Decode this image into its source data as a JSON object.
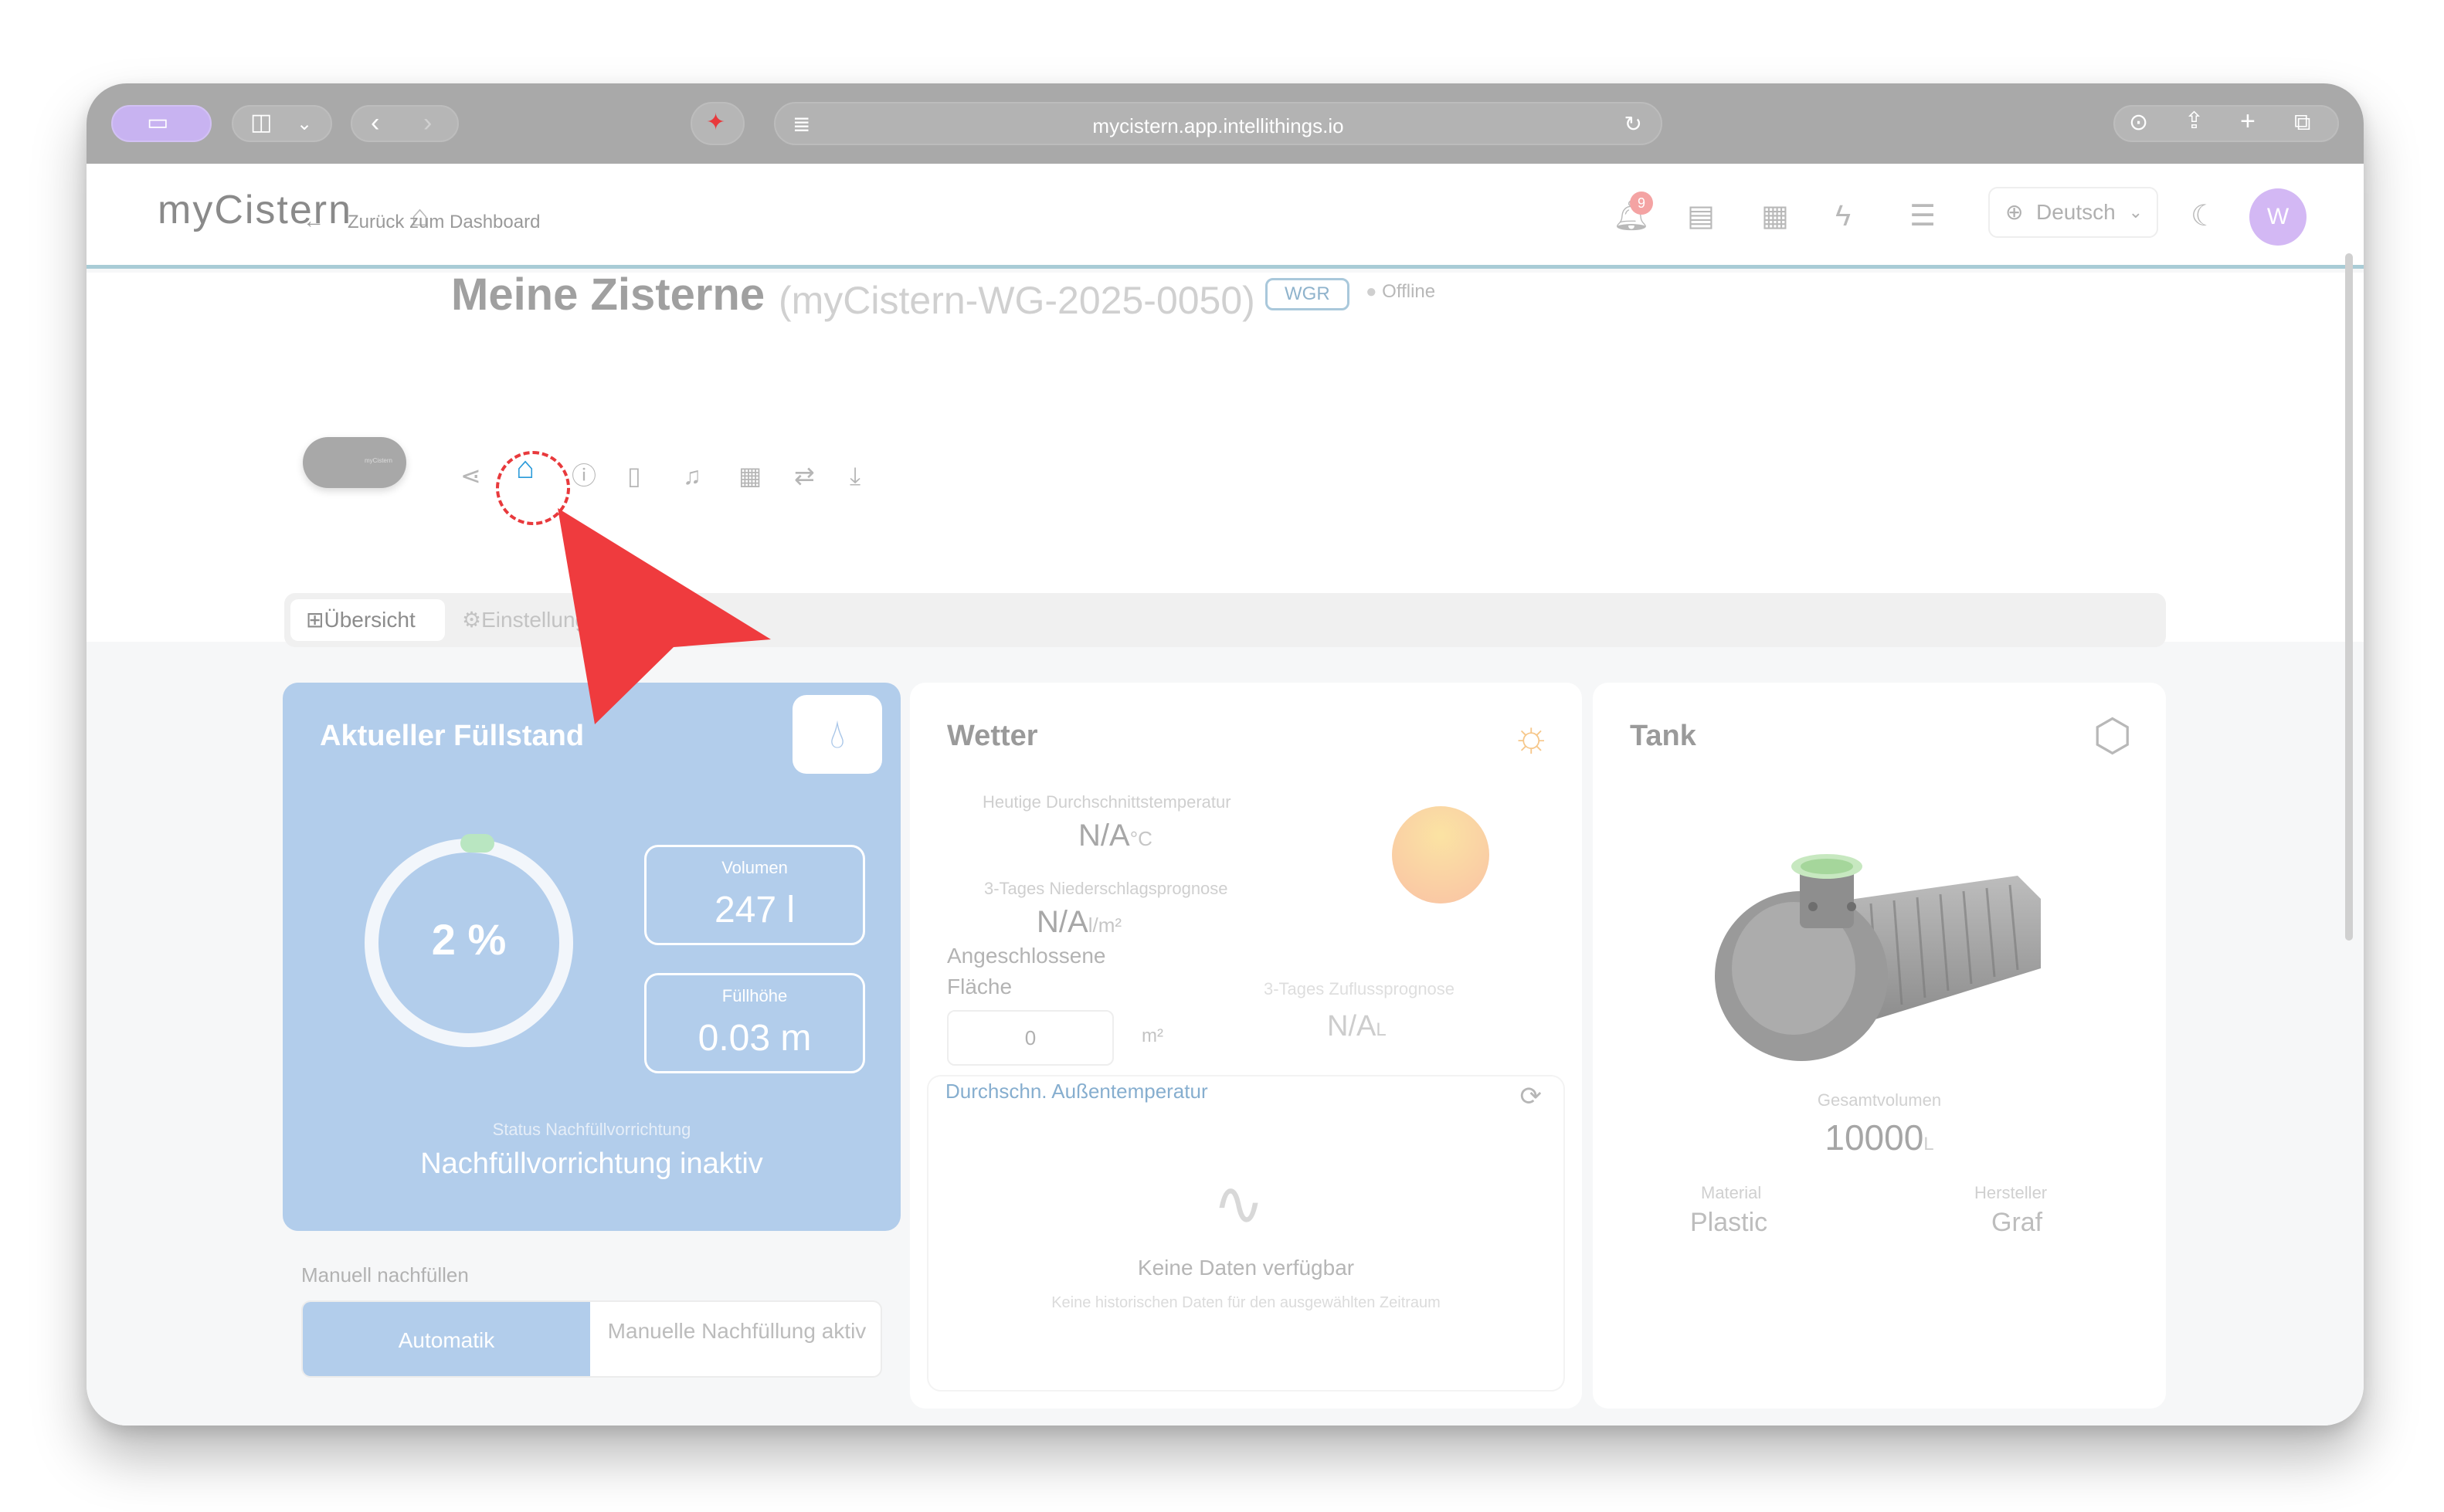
{
  "browser": {
    "url": "mycistern.app.intellithings.io"
  },
  "header": {
    "logo": "myCistern",
    "notification_count": "9",
    "language": "Deutsch",
    "avatar_initial": "W"
  },
  "page": {
    "back_label": "Zurück zum Dashboard",
    "title": "Meine Zisterne",
    "device_id": "(myCistern-WG-2025-0050)",
    "type_tag": "WGR",
    "status": "Offline",
    "device_label": "myCistern"
  },
  "tabs": {
    "overview": "Übersicht",
    "settings": "Einstellung"
  },
  "fill_card": {
    "title": "Aktueller Füllstand",
    "percent": "2 %",
    "level_fraction": 0.02,
    "volume_label": "Volumen",
    "volume_value": "247 l",
    "height_label": "Füllhöhe",
    "height_value": "0.03 m",
    "status_label": "Status Nachfüllvorrichtung",
    "status_value": "Nachfüllvorrichtung inaktiv"
  },
  "manual": {
    "label": "Manuell nachfüllen",
    "auto": "Automatik",
    "manual_active": "Manuelle Nachfüllung aktiv"
  },
  "weather": {
    "title": "Wetter",
    "avg_temp_label": "Heutige Durchschnittstemperatur",
    "avg_temp_value": "N/A",
    "avg_temp_unit": "°C",
    "precip_label": "3-Tages Niederschlagsprognose",
    "precip_value": "N/A",
    "precip_unit": "l/m²",
    "area_label": "Angeschlossene Fläche",
    "area_value": "0",
    "area_unit": "m²",
    "inflow_label": "3-Tages Zuflussprognose",
    "inflow_value": "N/A",
    "inflow_unit": "L",
    "chart_title": "Durchschn. Außentemperatur",
    "no_data": "Keine Daten verfügbar",
    "no_data_sub": "Keine historischen Daten für den ausgewählten Zeitraum"
  },
  "tank": {
    "title": "Tank",
    "total_label": "Gesamtvolumen",
    "total_value": "10000",
    "total_unit": "L",
    "material_label": "Material",
    "material_value": "Plastic",
    "maker_label": "Hersteller",
    "maker_value": "Graf"
  },
  "colors": {
    "accent_blue": "#b2cdeb",
    "highlight_red": "#e8393c",
    "chart_title": "#86aecf"
  }
}
